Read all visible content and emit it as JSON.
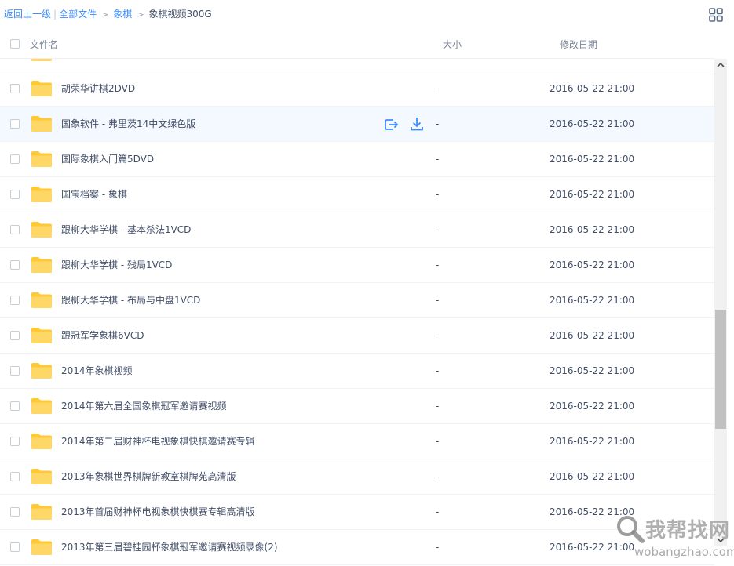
{
  "breadcrumb": {
    "back": "返回上一级",
    "separator": "|",
    "all_files": "全部文件",
    "arrow": ">",
    "level1": "象棋",
    "current": "象棋视频300G"
  },
  "header": {
    "name": "文件名",
    "size": "大小",
    "modified": "修改日期"
  },
  "rows": [
    {
      "name": "",
      "size": "",
      "date": ""
    },
    {
      "name": "胡荣华讲棋2DVD",
      "size": "-",
      "date": "2016-05-22 21:00"
    },
    {
      "name": "国象软件 - 弗里茨14中文绿色版",
      "size": "-",
      "date": "2016-05-22 21:00"
    },
    {
      "name": "国际象棋入门篇5DVD",
      "size": "-",
      "date": "2016-05-22 21:00"
    },
    {
      "name": "国宝档案 - 象棋",
      "size": "-",
      "date": "2016-05-22 21:00"
    },
    {
      "name": "跟柳大华学棋 - 基本杀法1VCD",
      "size": "-",
      "date": "2016-05-22 21:00"
    },
    {
      "name": "跟柳大华学棋 - 残局1VCD",
      "size": "-",
      "date": "2016-05-22 21:00"
    },
    {
      "name": "跟柳大华学棋 - 布局与中盘1VCD",
      "size": "-",
      "date": "2016-05-22 21:00"
    },
    {
      "name": "跟冠军学象棋6VCD",
      "size": "-",
      "date": "2016-05-22 21:00"
    },
    {
      "name": "2014年象棋视频",
      "size": "-",
      "date": "2016-05-22 21:00"
    },
    {
      "name": "2014年第六届全国象棋冠军邀请赛视频",
      "size": "-",
      "date": "2016-05-22 21:00"
    },
    {
      "name": "2014年第二届财神杯电视象棋快棋邀请赛专辑",
      "size": "-",
      "date": "2016-05-22 21:00"
    },
    {
      "name": "2013年象棋世界棋牌新教室棋牌苑高清版",
      "size": "-",
      "date": "2016-05-22 21:00"
    },
    {
      "name": "2013年首届财神杯电视象棋快棋赛专辑高清版",
      "size": "-",
      "date": "2016-05-22 21:00"
    },
    {
      "name": "2013年第三届碧桂园杯象棋冠军邀请赛视频录像(2)",
      "size": "-",
      "date": "2016-05-22 21:00"
    }
  ],
  "hovered_row_index": 2,
  "watermark": {
    "text": "我帮找网",
    "url": "wobangzhao.com"
  },
  "colors": {
    "accent": "#3b8cff",
    "folder": "#ffd25b",
    "hover_row": "#f4f8ff"
  },
  "icons": {
    "view_toggle": "grid-view-icon",
    "folder": "folder-icon",
    "share": "share-icon",
    "download": "download-icon",
    "scroll_up": "chevron-up-icon",
    "scroll_down": "chevron-down-icon"
  }
}
